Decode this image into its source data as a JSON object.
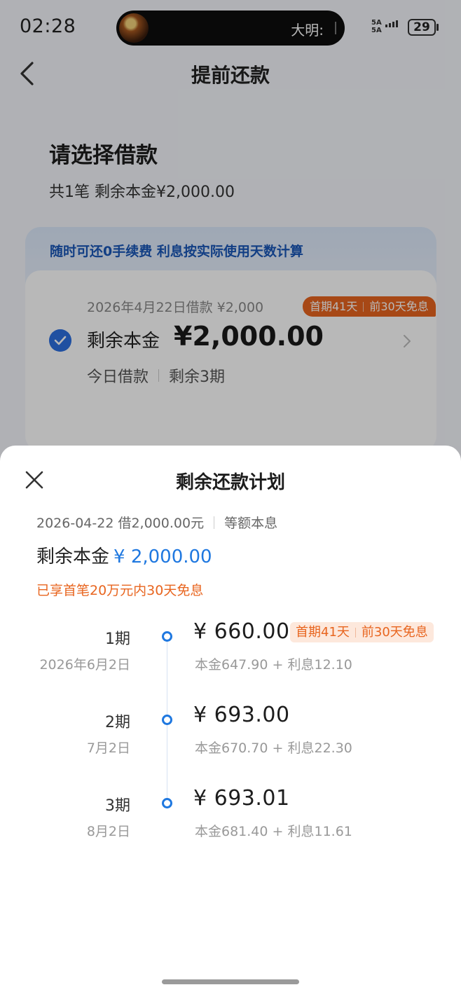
{
  "status_bar": {
    "time": "02:28",
    "island_text": "大明:",
    "signal": "5A 5A",
    "battery": "29"
  },
  "nav": {
    "title": "提前还款"
  },
  "section": {
    "title": "请选择借款",
    "subtitle": "共1笔 剩余本金¥2,000.00"
  },
  "promo": {
    "text": "随时可还0手续费 利息按实际使用天数计算"
  },
  "loan": {
    "date_line": "2026年4月22日借款 ¥2,000",
    "badge_a": "首期41天",
    "badge_b": "前30天免息",
    "label": "剩余本金",
    "amount": "¥2,000.00",
    "meta_a": "今日借款",
    "meta_b": "剩余3期"
  },
  "sheet": {
    "title": "剩余还款计划",
    "summary_a": "2026-04-22 借2,000.00元",
    "summary_b": "等额本息",
    "remain_label": "剩余本金",
    "remain_value": "¥ 2,000.00",
    "notice": "已享首笔20万元内30天免息",
    "installments": [
      {
        "period": "1期",
        "due": "2026年6月2日",
        "amount": "¥ 660.00",
        "breakdown": "本金647.90 + 利息12.10",
        "badge_a": "首期41天",
        "badge_b": "前30天免息"
      },
      {
        "period": "2期",
        "due": "7月2日",
        "amount": "¥ 693.00",
        "breakdown": "本金670.70 + 利息22.30"
      },
      {
        "period": "3期",
        "due": "8月2日",
        "amount": "¥ 693.01",
        "breakdown": "本金681.40 + 利息11.61"
      }
    ]
  },
  "colors": {
    "accent": "#1f78e0",
    "orange": "#e8651f",
    "check": "#2d6fe0"
  }
}
